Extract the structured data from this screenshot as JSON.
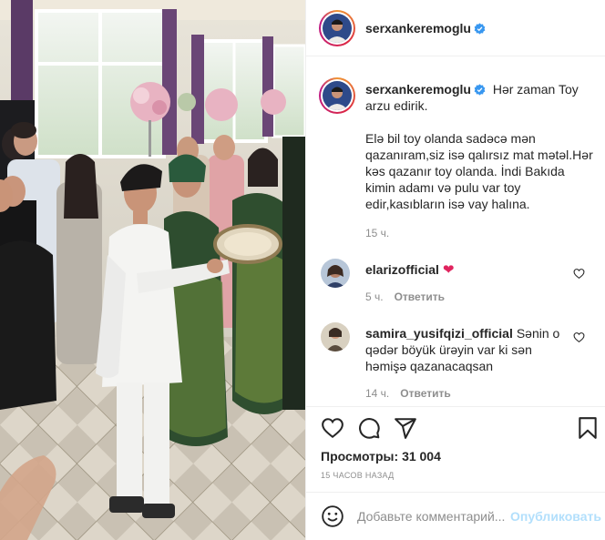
{
  "post": {
    "author": "serxankeremoglu",
    "caption_line1": "Hər zaman Toy arzu edirik.",
    "caption_body": "Elə bil toy olanda sadəcə mən qazanıram,siz isə qalırsız mat mətəl.Hər kəs qazanır toy olanda. İndi Bakıda kimin adamı və pulu var toy edir,kasıbların isə vay halına.",
    "caption_time": "15 ч."
  },
  "comments": [
    {
      "user": "elarizofficial",
      "text": "",
      "emoji": "❤",
      "time": "5 ч.",
      "reply_label": "Ответить"
    },
    {
      "user": "samira_yusifqizi_official",
      "text": "Sənin o qədər böyük ürəyin var ki sən həmişə qazanacaqsan",
      "emoji": "",
      "time": "14 ч.",
      "reply_label": "Ответить"
    }
  ],
  "stats": {
    "views_label": "Просмотры:",
    "views_count": "31 004",
    "posted_ago": "15 часов назад"
  },
  "comment_box": {
    "placeholder": "Добавьте комментарий...",
    "publish_label": "Опубликовать"
  },
  "colors": {
    "verified": "#3897f0",
    "publish_disabled": "#b2dffc",
    "heart": "#ed4956"
  },
  "icons": [
    "verified-badge-icon",
    "heart-icon",
    "comment-icon",
    "share-icon",
    "bookmark-icon",
    "emoji-icon",
    "heart-small-icon"
  ]
}
